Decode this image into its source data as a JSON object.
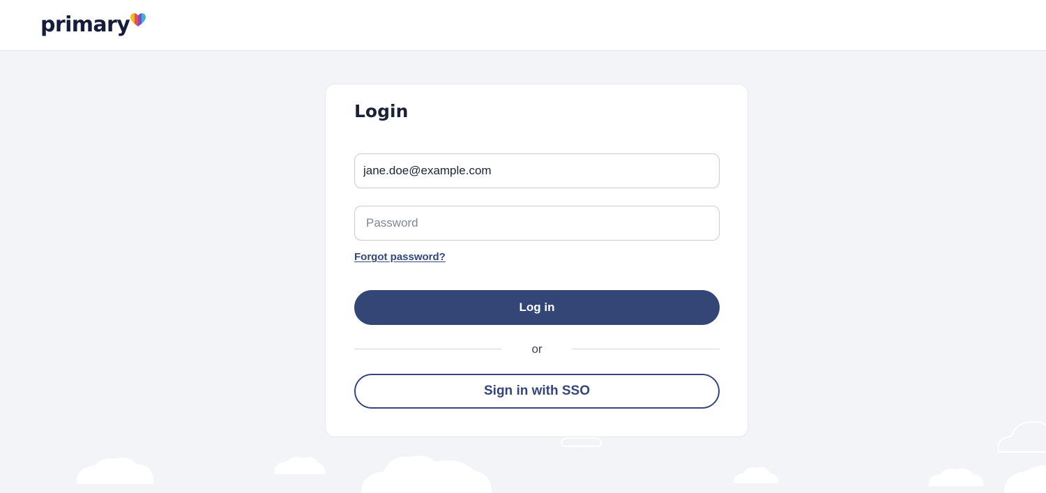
{
  "header": {
    "logo_text": "primary",
    "logo_colors": [
      "#f2b81e",
      "#e8504f",
      "#3fb0d0",
      "#7a4fc6"
    ]
  },
  "login": {
    "title": "Login",
    "email_value": "jane.doe@example.com",
    "password_placeholder": "Password",
    "forgot_label": "Forgot password?",
    "login_label": "Log in",
    "or_label": "or",
    "sso_label": "Sign in with SSO"
  },
  "colors": {
    "primary": "#344676",
    "background": "#f3f4f7",
    "text": "#1b2236"
  }
}
